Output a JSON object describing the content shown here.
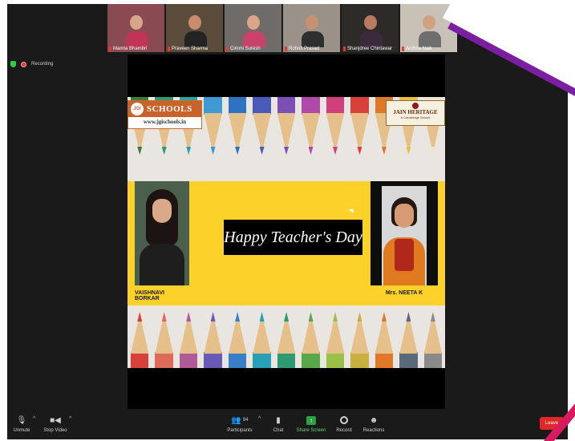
{
  "participants_strip": [
    {
      "name": "Mamta Bhambri",
      "bg": "#8a4a52",
      "skin": "#d7a58a",
      "shirt": "#c03456"
    },
    {
      "name": "Praveen Sharma",
      "bg": "#5b4b3b",
      "skin": "#c98d6d",
      "shirt": "#232323"
    },
    {
      "name": "Cimmi Suresh",
      "bg": "#6f6b68",
      "skin": "#d9a48a",
      "shirt": "#c8426a"
    },
    {
      "name": "Rohnit Prasad",
      "bg": "#9a9189",
      "skin": "#c69072",
      "shirt": "#2f2f2f"
    },
    {
      "name": "Shanjdree Chintawar",
      "bg": "#2d2a28",
      "skin": "#b67b62",
      "shirt": "#3b2a3b"
    },
    {
      "name": "Archna Naik",
      "bg": "#c8c1b7",
      "skin": "#d0a182",
      "shirt": "#6e6e6e"
    }
  ],
  "next_page_icon": "chevron-right",
  "recording": {
    "label": "Recording"
  },
  "slide": {
    "logo_left": {
      "mark": "JGI",
      "title": "SCHOOLS",
      "url": "www.jgischools.in"
    },
    "logo_right": {
      "title": "JAIN HERITAGE",
      "subtitle": "A Cambridge School"
    },
    "banner": "Happy Teacher's Day",
    "student_name": "VAISHNAVI BORKAR",
    "teacher_name": "Mrs. NEETA K",
    "pencil_colors_top": [
      "#3a7d3a",
      "#2e9a72",
      "#2aa7a5",
      "#3f9ad3",
      "#2e72c4",
      "#4a5ab8",
      "#7b4fb6",
      "#b04aa8",
      "#d0407a",
      "#d8403a",
      "#e0782a",
      "#eac042",
      "#ece6d0"
    ],
    "pencil_colors_bottom": [
      "#d8403a",
      "#e06a5a",
      "#b05a9a",
      "#6a5ab8",
      "#3a7ec8",
      "#2aa0b8",
      "#2e9a72",
      "#58a848",
      "#9ac048",
      "#c8b040",
      "#e0782a",
      "#5a6a7a",
      "#8a8a8a"
    ]
  },
  "toolbar": {
    "unmute": "Unmute",
    "stop_video": "Stop Video",
    "participants": "Participants",
    "participants_count": "94",
    "chat": "Chat",
    "share_screen": "Share Screen",
    "record": "Record",
    "reactions": "Reactions",
    "leave": "Leave"
  },
  "colors": {
    "background": "#1a1a1a",
    "slide_yellow": "#fcd12a",
    "share_green": "#2ea043",
    "leave_red": "#e02828",
    "accent_blue": "#2d8cff"
  }
}
